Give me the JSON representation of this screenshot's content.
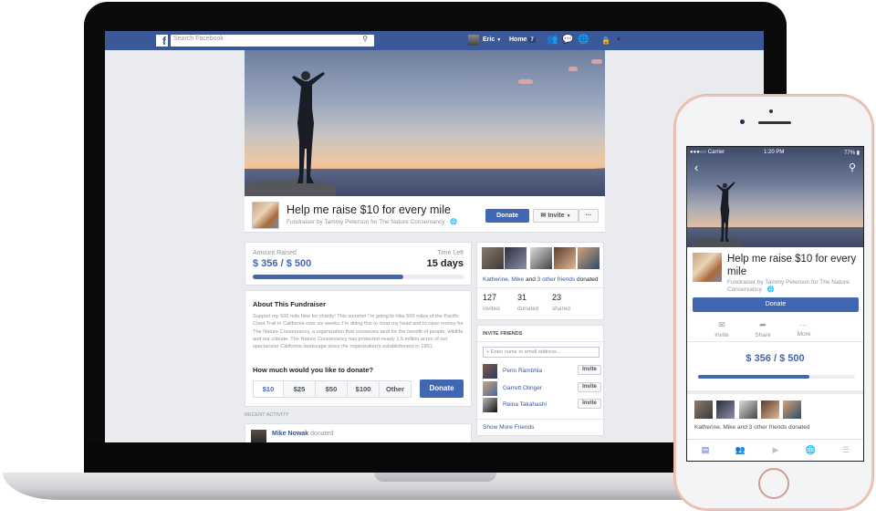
{
  "topbar": {
    "logo": "f",
    "search_placeholder": "Search Facebook",
    "user_name": "Eric",
    "home_label": "Home",
    "home_count": "7",
    "icons": [
      "friend-requests-icon",
      "messages-icon",
      "notifications-globe-icon",
      "privacy-lock-icon",
      "account-dropdown-icon"
    ]
  },
  "fundraiser": {
    "title": "Help me raise $10 for every mile",
    "subtitle": "Fundraiser by Tammy Peterson for The Nature Conservancy · ",
    "donate_label": "Donate",
    "invite_label": "Invite",
    "more_label": "···",
    "amount_raised_label": "Amount Raised",
    "amount_raised": "$ 356 / $ 500",
    "progress_fraction": 0.712,
    "time_left_label": "Time Left",
    "time_left": "15 days",
    "about_heading": "About This Fundraiser",
    "about_text": "Support my 500 mile hike for charity! This summer I'm going to hike 500 miles of the Pacific Crest Trail in California over six weeks. I'm doing this to clear my head and to raise money for The Nature Conservancy, a organization that conserves land for the benefit of people, wildlife and our climate. The Nature Conservancy has protected nearly 1.5 million acres of our spectacular California landscape since the organization's establishment in 1951.",
    "donate_question": "How much would you like to donate?",
    "amounts": [
      "$10",
      "$25",
      "$50",
      "$100",
      "Other"
    ],
    "selected_amount": "$10",
    "donate_button": "Donate"
  },
  "recent_activity": {
    "heading": "RECENT ACTIVITY",
    "items": [
      {
        "name": "Mike Nowak",
        "action": "donated"
      }
    ]
  },
  "friends_donated": {
    "names_link": "Katherine, Mike",
    "and_text": " and ",
    "others_link": "3 other friends",
    "suffix": " donated",
    "stats": [
      {
        "value": "127",
        "label": "invited"
      },
      {
        "value": "31",
        "label": "donated"
      },
      {
        "value": "23",
        "label": "shared"
      }
    ]
  },
  "invite_friends": {
    "heading": "INVITE FRIENDS",
    "input_placeholder": "Enter name or email address...",
    "friends": [
      {
        "name": "Perin Rambhia",
        "button": "Invite"
      },
      {
        "name": "Garrett Olinger",
        "button": "Invite"
      },
      {
        "name": "Reina Takahashi",
        "button": "Invite"
      }
    ],
    "show_more": "Show More Friends"
  },
  "mobile": {
    "carrier": "●●●○○ Carrier",
    "time": "1:20 PM",
    "battery": "77%",
    "title": "Help me raise $10 for every mile",
    "subtitle": "Fundraiser by Tammy Peterson for The Nature Conservancy · ",
    "donate_label": "Donate",
    "actions": [
      {
        "label": "Invite",
        "icon": "envelope-icon"
      },
      {
        "label": "Share",
        "icon": "share-arrow-icon"
      },
      {
        "label": "More",
        "icon": "more-dots-icon"
      }
    ],
    "amount": "$ 356 / $ 500",
    "progress_fraction": 0.712,
    "friends_text": "Katherine, Mike and 3 other friends donated",
    "tabbar": [
      "news-feed-icon",
      "friends-icon",
      "video-icon",
      "globe-icon",
      "menu-icon"
    ]
  },
  "colors": {
    "fb_blue": "#3b5998",
    "button_blue": "#4267b2",
    "link_blue": "#365899",
    "rose_gold": "#efc3b5"
  }
}
